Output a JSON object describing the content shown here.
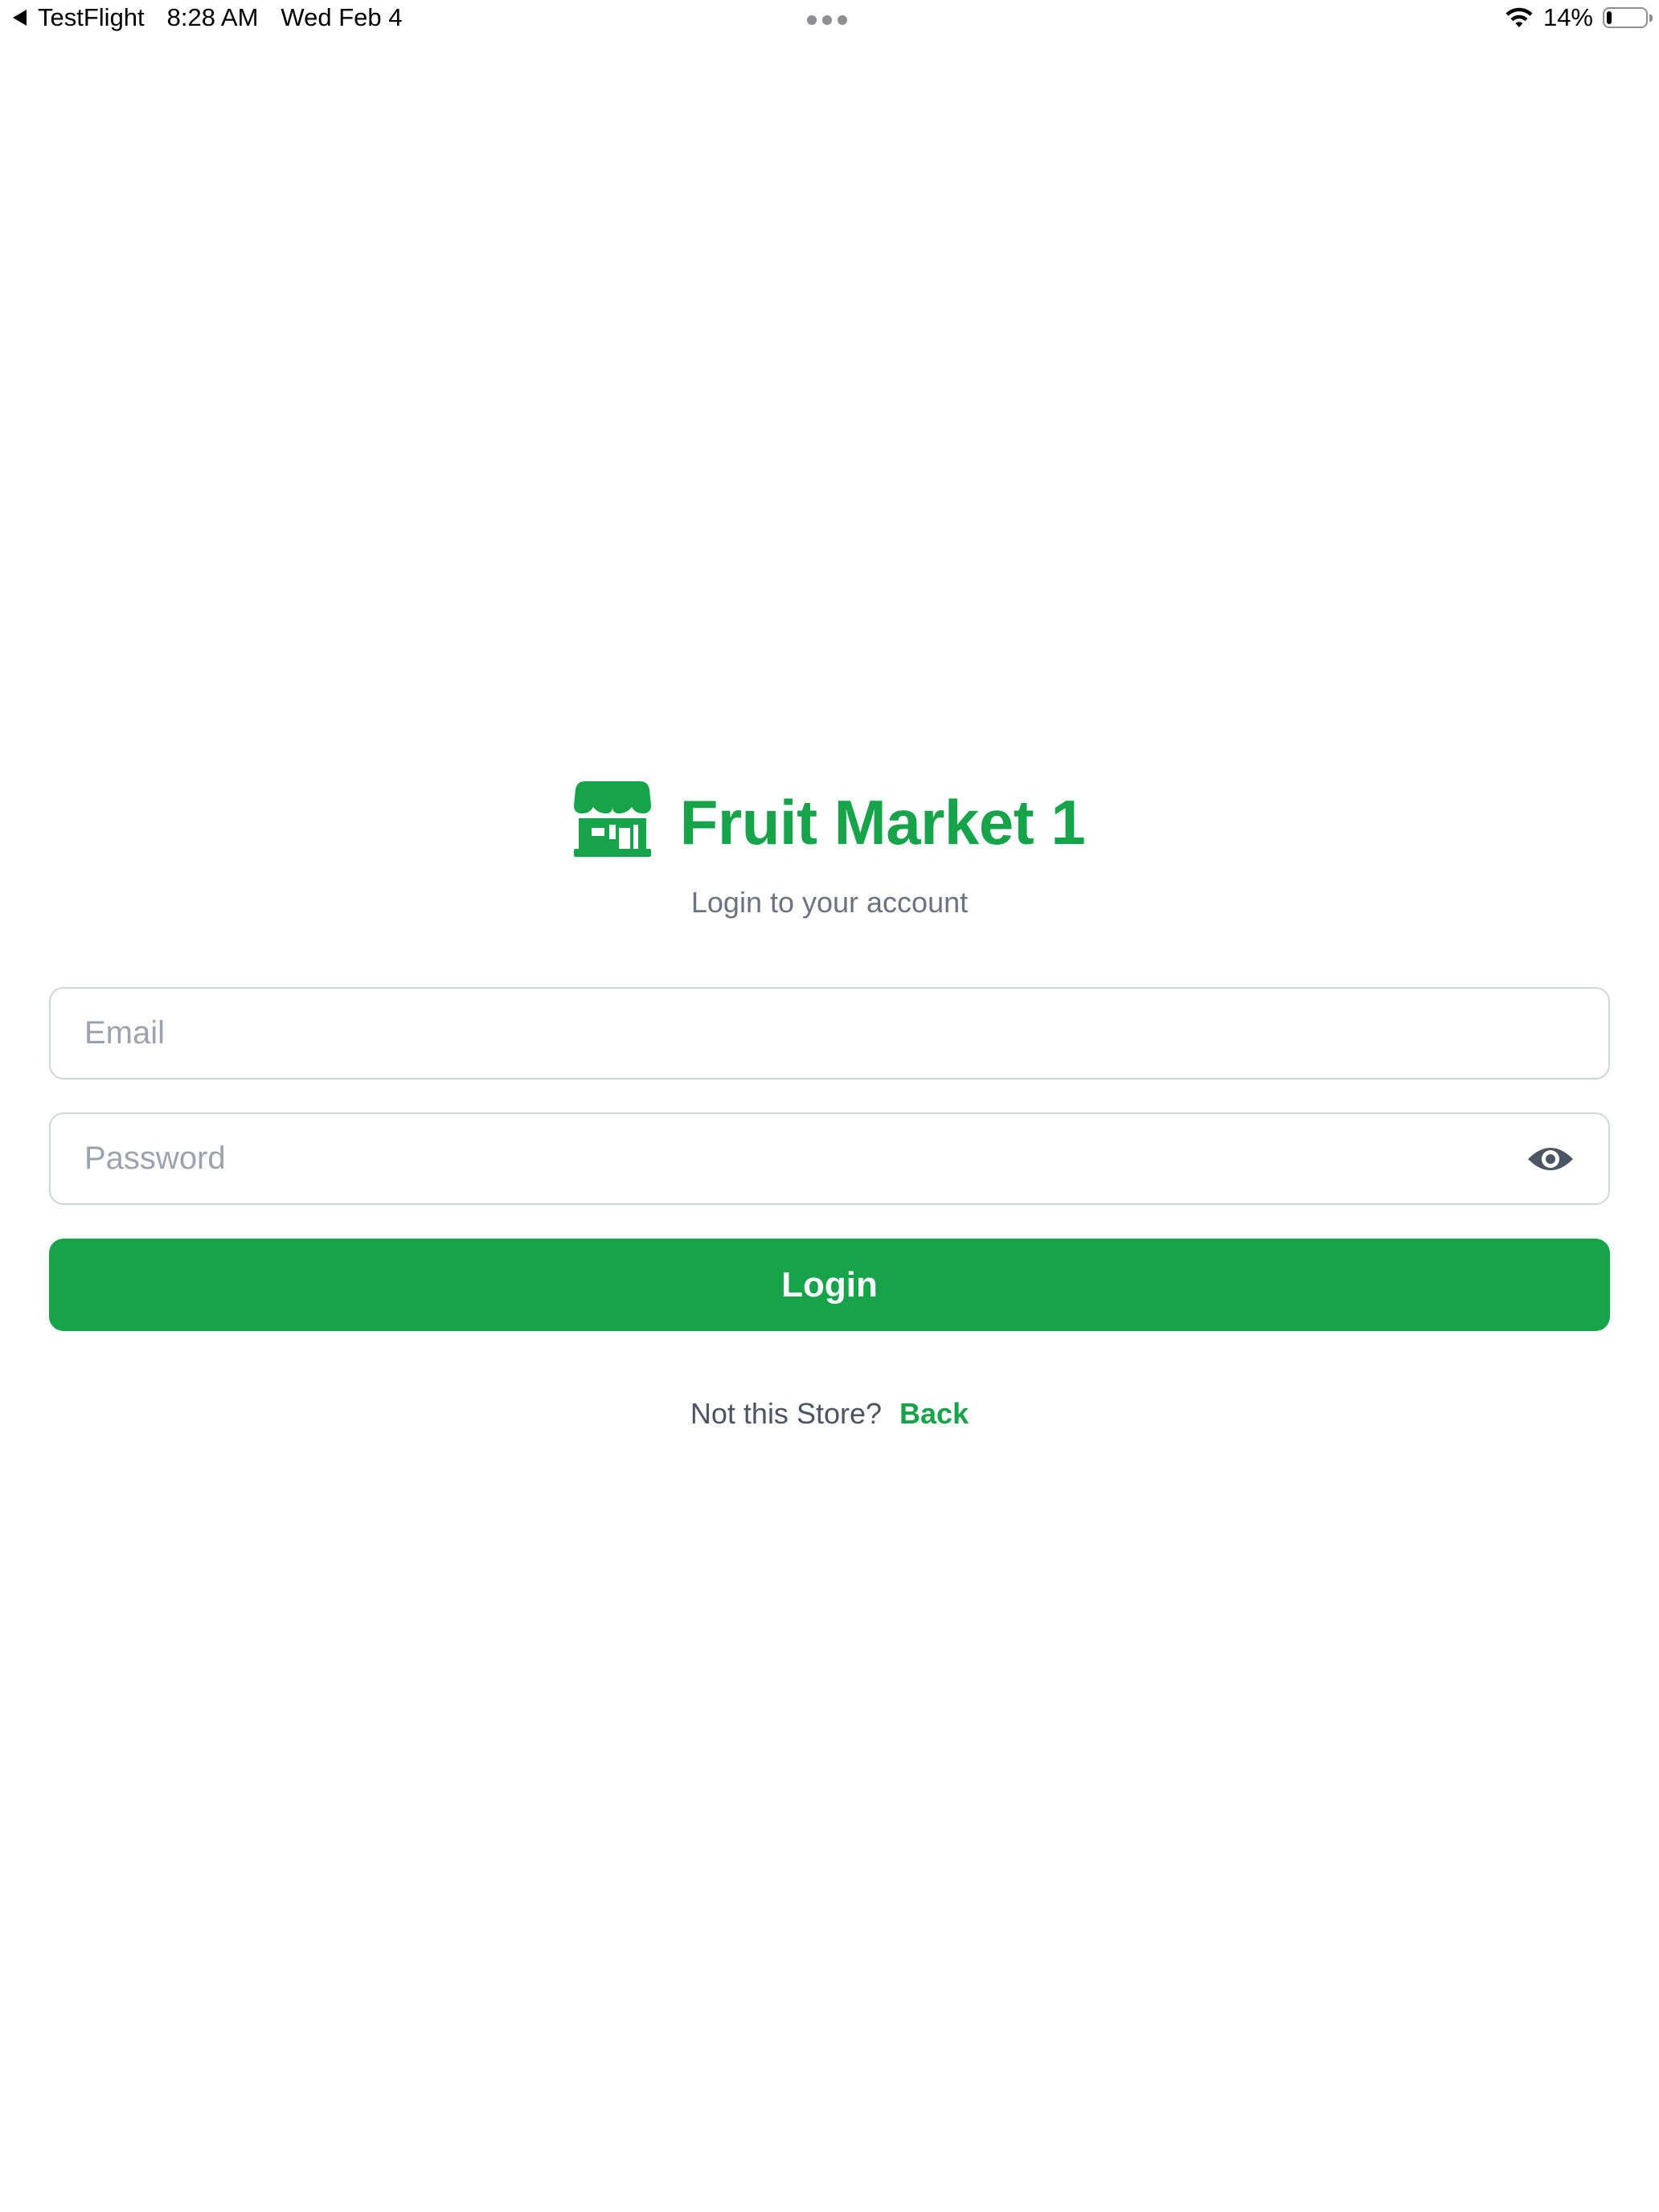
{
  "status_bar": {
    "back_app": "TestFlight",
    "time": "8:28 AM",
    "date": "Wed Feb 4",
    "battery_percent": "14%",
    "battery_level": 0.14,
    "icons": [
      "back-arrow-icon",
      "wifi-icon",
      "battery-icon"
    ]
  },
  "brand": {
    "title": "Fruit Market 1",
    "icon": "store-icon",
    "color": "#16a34a"
  },
  "login": {
    "subtitle": "Login to your account",
    "email_value": "",
    "email_placeholder": "Email",
    "password_value": "",
    "password_placeholder": "Password",
    "password_toggle_icon": "eye-icon",
    "button_label": "Login",
    "button_color": "#16a34a"
  },
  "footer": {
    "prompt": "Not this Store?",
    "link_label": "Back"
  }
}
